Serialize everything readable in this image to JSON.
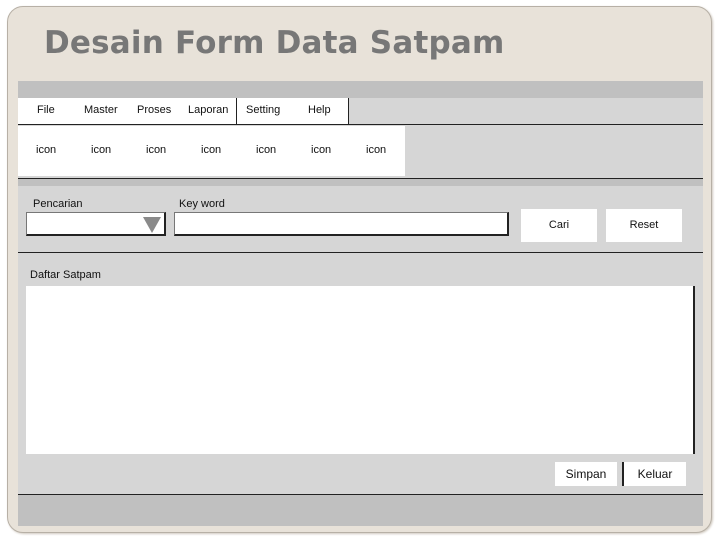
{
  "slide": {
    "title": "Desain Form Data Satpam"
  },
  "menu": [
    "File",
    "Master",
    "Proses",
    "Laporan",
    "Setting",
    "Help"
  ],
  "toolbar": [
    "icon",
    "icon",
    "icon",
    "icon",
    "icon",
    "icon",
    "icon"
  ],
  "search": {
    "category_label": "Pencarian",
    "category_value": "",
    "keyword_label": "Key word",
    "keyword_value": "",
    "search_button": "Cari",
    "reset_button": "Reset"
  },
  "list": {
    "label": "Daftar Satpam"
  },
  "actions": {
    "save": "Simpan",
    "exit": "Keluar"
  },
  "colors": {
    "title": "#777777",
    "form_background": "#d6d6d6",
    "strip": "#c0c0c0",
    "slide_background": "#e8e2d9"
  }
}
